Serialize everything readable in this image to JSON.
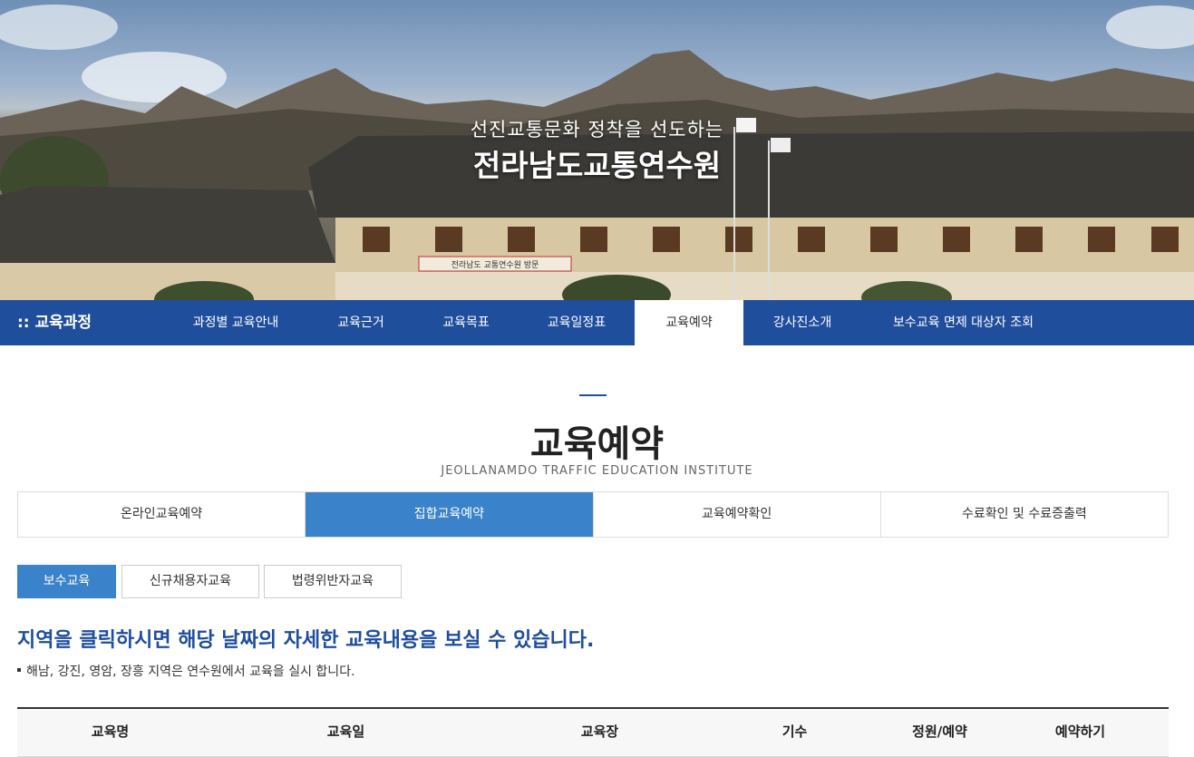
{
  "hero": {
    "subtitle": "선진교통문화 정착을 선도하는",
    "title": "전라남도교통연수원",
    "banner_sign": "전라남도 교통연수원 방문"
  },
  "gnb": {
    "category": ":: 교육과정",
    "items": [
      {
        "label": "과정별 교육안내"
      },
      {
        "label": "교육근거"
      },
      {
        "label": "교육목표"
      },
      {
        "label": "교육일정표"
      },
      {
        "label": "교육예약"
      },
      {
        "label": "강사진소개"
      },
      {
        "label": "보수교육 면제 대상자 조회"
      }
    ],
    "active_index": 4
  },
  "page": {
    "title": "교육예약",
    "subtitle": "JEOLLANAMDO TRAFFIC EDUCATION INSTITUTE"
  },
  "tabs": [
    {
      "label": "온라인교육예약"
    },
    {
      "label": "집합교육예약"
    },
    {
      "label": "교육예약확인"
    },
    {
      "label": "수료확인 및 수료증출력"
    }
  ],
  "subtabs": [
    {
      "label": "보수교육"
    },
    {
      "label": "신규채용자교육"
    },
    {
      "label": "법령위반자교육"
    }
  ],
  "info": {
    "heading": "지역을 클릭하시면 해당 날짜의 자세한 교육내용을 보실 수 있습니다.",
    "note": "해남, 강진, 영암, 장흥 지역은 연수원에서 교육을 실시 합니다."
  },
  "table": {
    "headers": [
      "교육명",
      "교육일",
      "교육장",
      "기수",
      "정원/예약",
      "예약하기"
    ]
  },
  "colors": {
    "nav_blue": "#1f4e9c",
    "tab_active": "#3a82c9"
  }
}
